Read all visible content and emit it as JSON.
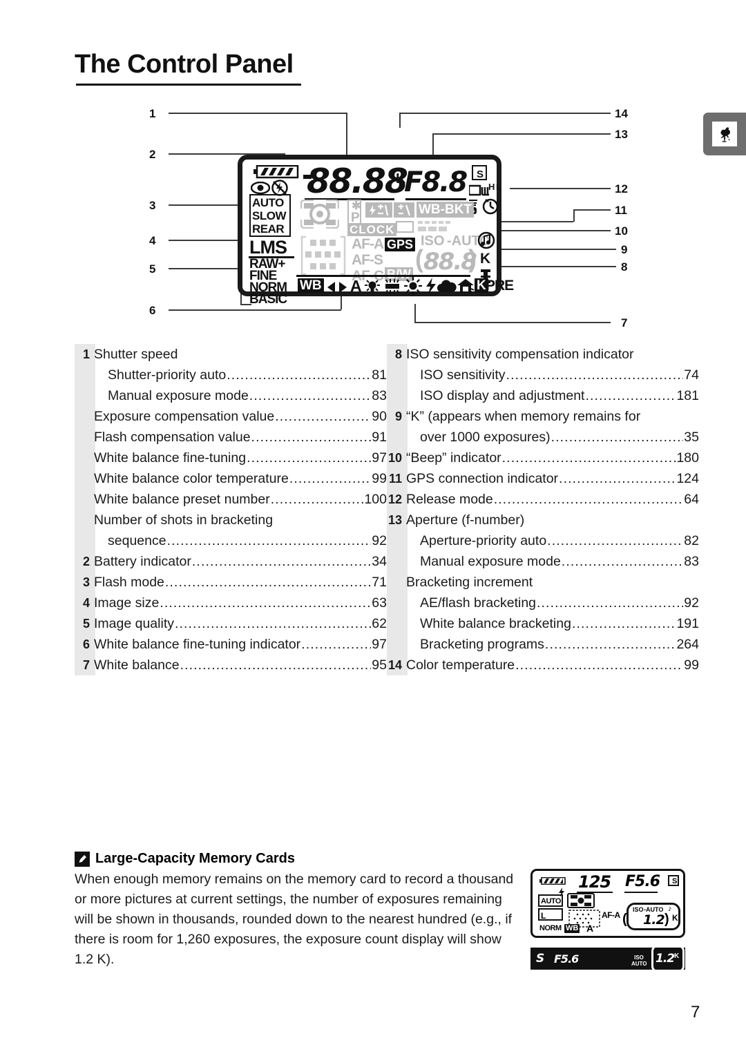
{
  "page": {
    "title": "The Control Panel",
    "number": "7",
    "margin_tab_icon": "rooster-icon"
  },
  "diagram": {
    "callouts_left": [
      "1",
      "2",
      "3",
      "4",
      "5",
      "6"
    ],
    "callouts_right": [
      "14",
      "13",
      "12",
      "11",
      "10",
      "9",
      "8",
      "7"
    ],
    "lcd": {
      "shutter_speed": "88.88",
      "k_symbol": "K",
      "aperture": "F8.8",
      "battery": "battery-full-icon",
      "flash_red_eye": "eye-icon",
      "flash_off": "flash-off-icon",
      "flash_modes": [
        "AUTO",
        "SLOW",
        "REAR"
      ],
      "image_size": "LMS",
      "image_quality": [
        "RAW+",
        "FINE",
        "NORM",
        "BASIC"
      ],
      "metering": "matrix-metering-icon",
      "af_points": "af-point-grid-icon",
      "flexible_program": "P",
      "clock": "CLOCK",
      "flash_comp": "flash-compensation-icon",
      "exposure_comp": "exposure-compensation-icon",
      "wb_bkt": "WB-BKT",
      "bracket_bar": "bracketing-scale-icon",
      "af_modes": [
        "AF-A",
        "AF-S",
        "AF-C"
      ],
      "gps": "GPS",
      "bw": "B/W",
      "iso_label": "ISO",
      "iso_auto_label": "-AUTO",
      "iso_value": "88.8",
      "beep": "beep-icon",
      "k_indicator": "K",
      "memory_card": "memory-card-icon",
      "release_s": "S",
      "release_continuous": "continuous-icon",
      "release_ch_cl": "H L",
      "release_quiet": "quiet-icon",
      "release_timer": "self-timer-icon",
      "wb_label": "WB",
      "wb_finetune": "fine-tune-arrows-icon",
      "wb_auto": "A",
      "wb_incandescent": "incandescent-icon",
      "wb_fluorescent": "fluorescent-icon",
      "wb_daylight": "daylight-icon",
      "wb_flash": "flash-icon",
      "wb_cloudy": "cloudy-icon",
      "wb_shade": "shade-icon",
      "wb_k": "K",
      "wb_pre": "PRE"
    }
  },
  "index": {
    "left": [
      {
        "n": "1",
        "label": "Shutter speed",
        "page": "",
        "indent": 0,
        "dots": false
      },
      {
        "n": "",
        "label": "Shutter-priority auto",
        "page": "81",
        "indent": 1,
        "dots": true
      },
      {
        "n": "",
        "label": "Manual exposure mode",
        "page": "83",
        "indent": 1,
        "dots": true
      },
      {
        "n": "",
        "label": "Exposure compensation value",
        "page": "90",
        "indent": 0,
        "dots": true
      },
      {
        "n": "",
        "label": "Flash compensation value",
        "page": "91",
        "indent": 0,
        "dots": true
      },
      {
        "n": "",
        "label": "White balance fine-tuning",
        "page": "97",
        "indent": 0,
        "dots": true
      },
      {
        "n": "",
        "label": "White balance color temperature",
        "page": "99",
        "indent": 0,
        "dots": true
      },
      {
        "n": "",
        "label": "White balance preset number",
        "page": "100",
        "indent": 0,
        "dots": true
      },
      {
        "n": "",
        "label": "Number of shots in bracketing",
        "page": "",
        "indent": 0,
        "dots": false
      },
      {
        "n": "",
        "label": "sequence",
        "page": "92",
        "indent": 1,
        "dots": true
      },
      {
        "n": "2",
        "label": "Battery indicator",
        "page": "34",
        "indent": 0,
        "dots": true
      },
      {
        "n": "3",
        "label": "Flash mode",
        "page": "71",
        "indent": 0,
        "dots": true
      },
      {
        "n": "4",
        "label": "Image size",
        "page": "63",
        "indent": 0,
        "dots": true
      },
      {
        "n": "5",
        "label": "Image quality",
        "page": "62",
        "indent": 0,
        "dots": true
      },
      {
        "n": "6",
        "label": "White balance fine-tuning indicator",
        "page": "97",
        "indent": 0,
        "dots": true
      },
      {
        "n": "7",
        "label": "White balance",
        "page": "95",
        "indent": 0,
        "dots": true
      }
    ],
    "right": [
      {
        "n": "8",
        "label": "ISO sensitivity compensation indicator",
        "page": "",
        "indent": 0,
        "dots": false
      },
      {
        "n": "",
        "label": "ISO sensitivity",
        "page": "74",
        "indent": 1,
        "dots": true
      },
      {
        "n": "",
        "label": "ISO display and adjustment",
        "page": "181",
        "indent": 1,
        "dots": true
      },
      {
        "n": "9",
        "label": "“K” (appears when memory remains for",
        "page": "",
        "indent": 0,
        "dots": false
      },
      {
        "n": "",
        "label": "over 1000 exposures)",
        "page": "35",
        "indent": 1,
        "dots": true
      },
      {
        "n": "10",
        "label": "“Beep” indicator",
        "page": "180",
        "indent": 0,
        "dots": true
      },
      {
        "n": "11",
        "label": "GPS connection indicator",
        "page": "124",
        "indent": 0,
        "dots": true
      },
      {
        "n": "12",
        "label": "Release mode",
        "page": "64",
        "indent": 0,
        "dots": true
      },
      {
        "n": "13",
        "label": "Aperture (f-number)",
        "page": "",
        "indent": 0,
        "dots": false
      },
      {
        "n": "",
        "label": "Aperture-priority auto",
        "page": "82",
        "indent": 1,
        "dots": true
      },
      {
        "n": "",
        "label": "Manual exposure mode",
        "page": "83",
        "indent": 1,
        "dots": true
      },
      {
        "n": "",
        "label": "Bracketing increment",
        "page": "",
        "indent": 0,
        "dots": false
      },
      {
        "n": "",
        "label": "AE/flash bracketing",
        "page": "92",
        "indent": 1,
        "dots": true
      },
      {
        "n": "",
        "label": "White balance bracketing",
        "page": "191",
        "indent": 1,
        "dots": true
      },
      {
        "n": "",
        "label": "Bracketing programs",
        "page": "264",
        "indent": 1,
        "dots": true
      },
      {
        "n": "14",
        "label": "Color temperature",
        "page": "99",
        "indent": 0,
        "dots": true
      }
    ]
  },
  "note": {
    "icon": "pencil-icon",
    "heading": "Large-Capacity Memory Cards",
    "body": "When enough memory remains on the memory card to record a thousand or more pictures at current settings, the number of exposures remaining will be shown in thousands, rounded down to the nearest hundred (e.g., if there is room for 1,260 exposures, the exposure count display will show 1.2 K)."
  },
  "sample_lcd": {
    "shutter_speed": "125",
    "aperture": "F5.6",
    "release_mode": "S",
    "flash_mode": "AUTO",
    "flash_icon": "flash-icon",
    "metering": "matrix-metering-icon",
    "image_size": "L",
    "image_quality": "NORM",
    "af_mode": "AF-A",
    "af_points": "af-point-grid-icon",
    "wb_label": "WB",
    "wb_value": "A",
    "iso_label": "ISO",
    "iso_auto": "-AUTO",
    "beep_icon": "beep-icon",
    "exposures": "1.2",
    "k_symbol": "K",
    "viewfinder": {
      "release_mode": "S",
      "aperture": "F5.6",
      "iso_auto": "ISO AUTO",
      "exposures": "1.2",
      "k_symbol": "K"
    }
  },
  "colors": {
    "text": "#1a1a1a",
    "lcd_gray": "#b9b9b9",
    "strip_gray": "#e8e8e8",
    "tab_gray": "#6e6e6e"
  }
}
